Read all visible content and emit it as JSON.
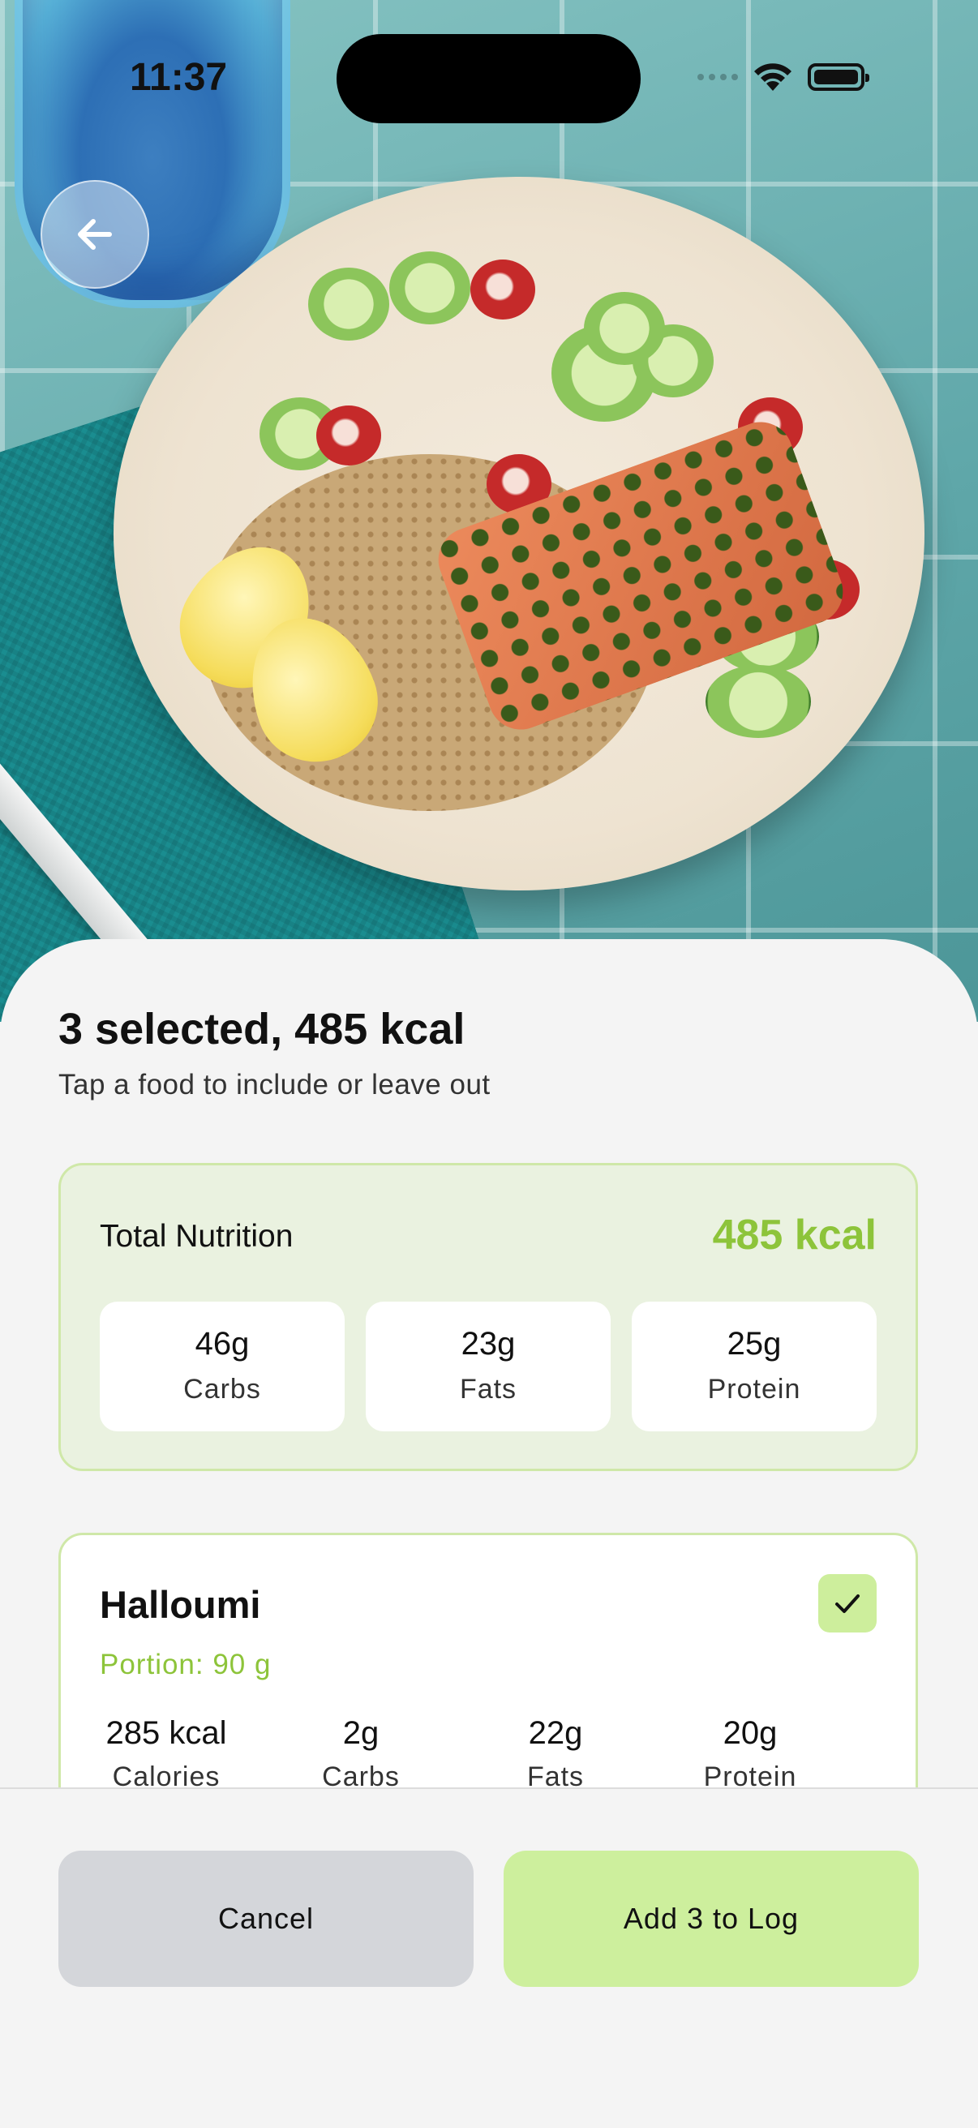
{
  "status_bar": {
    "time": "11:37"
  },
  "header": {
    "back_icon": "arrow-left-icon",
    "photo": "salmon-rice-salad-plate"
  },
  "summary": {
    "title": "3 selected, 485 kcal",
    "subtitle": "Tap a food to include or leave out"
  },
  "total": {
    "label": "Total Nutrition",
    "kcal": "485 kcal",
    "macros": [
      {
        "value": "46g",
        "label": "Carbs"
      },
      {
        "value": "23g",
        "label": "Fats"
      },
      {
        "value": "25g",
        "label": "Protein"
      }
    ]
  },
  "items": [
    {
      "name": "Halloumi",
      "portion": "Portion: 90 g",
      "selected": true,
      "stats": [
        {
          "value": "285 kcal",
          "label": "Calories"
        },
        {
          "value": "2g",
          "label": "Carbs"
        },
        {
          "value": "22g",
          "label": "Fats"
        },
        {
          "value": "20g",
          "label": "Protein"
        }
      ]
    }
  ],
  "footer": {
    "cancel_label": "Cancel",
    "add_label": "Add 3 to Log"
  },
  "colors": {
    "accent": "#8dc43a",
    "accent_light": "#cdef9d",
    "card_bg": "#eaf2e0",
    "cancel_bg": "#d4d6da"
  }
}
